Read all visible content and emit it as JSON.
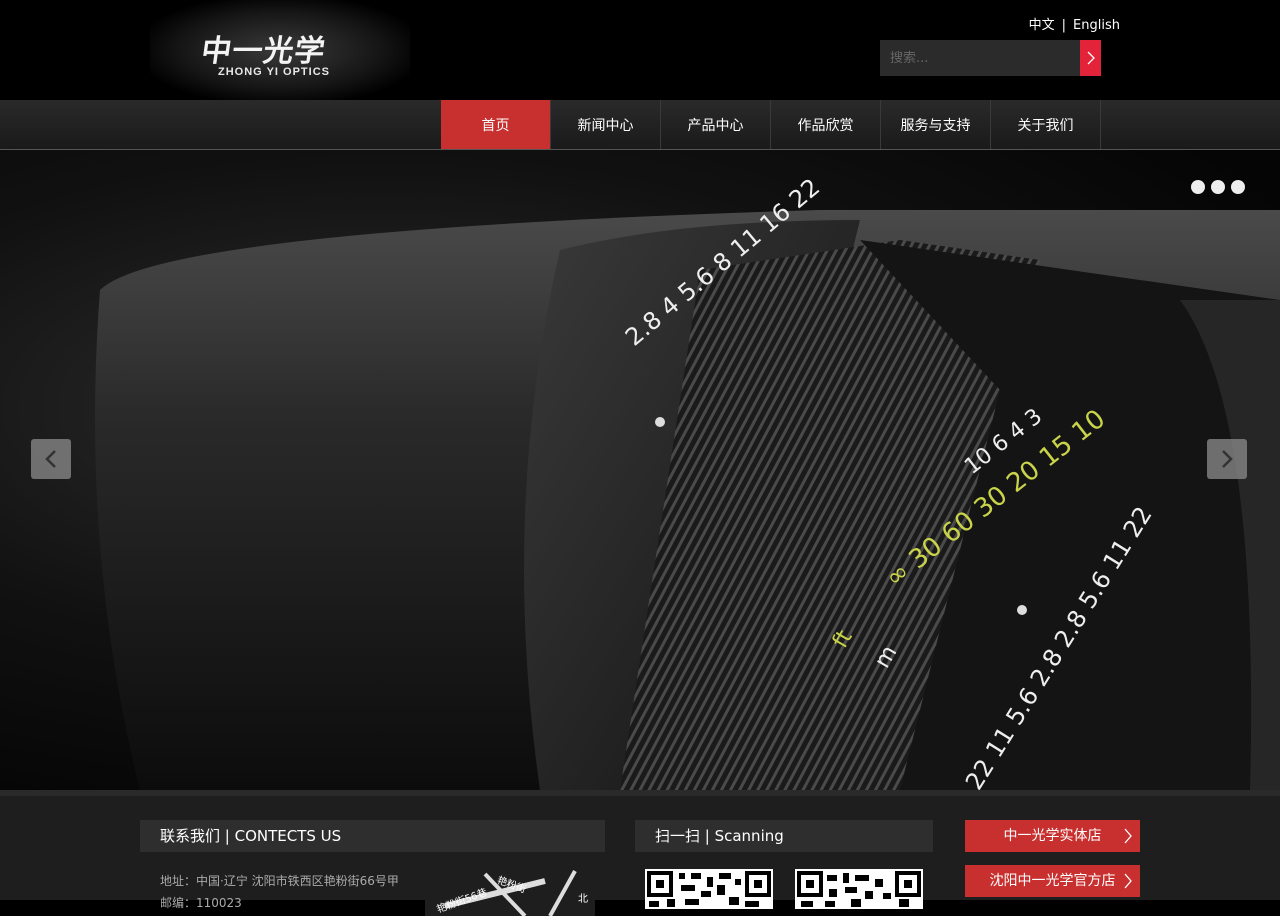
{
  "header": {
    "logo_cn": "中一光学",
    "logo_en": "ZHONG YI OPTICS",
    "lang_cn": "中文",
    "lang_sep": "|",
    "lang_en": "English",
    "search_placeholder": "搜索..."
  },
  "nav": {
    "items": [
      {
        "label": "首页"
      },
      {
        "label": "新闻中心"
      },
      {
        "label": "产品中心"
      },
      {
        "label": "作品欣赏"
      },
      {
        "label": "服务与支持"
      },
      {
        "label": "关于我们"
      }
    ],
    "active_index": 0
  },
  "banner": {
    "slide_count": 3,
    "lens_markings": {
      "aperture_top": "2.8  4  5.6  8  11  16  22",
      "distance_ft": "∞  30  60  30  20  15  10",
      "distance_m": "10  6  4  3",
      "unit_ft": "ft",
      "unit_m": "m",
      "dof_scale": "22 11 5.6 2.8 2.8 5.6 11 22"
    }
  },
  "footer": {
    "contact_title": "联系我们 | CONTECTS US",
    "address": "地址：中国·辽宁 沈阳市铁西区艳粉街66号甲",
    "postcode": "邮编：110023",
    "map_labels": {
      "street1": "艳粉街",
      "street2": "艳粉街56巷",
      "north": "北"
    },
    "scan_title": "扫一扫 | Scanning",
    "store_buttons": [
      "中一光学实体店",
      "沈阳中一光学官方店"
    ]
  },
  "colors": {
    "accent_red": "#c8302f",
    "search_red": "#e2233a",
    "background": "#000000",
    "footer_bg": "#1e1e1e"
  }
}
